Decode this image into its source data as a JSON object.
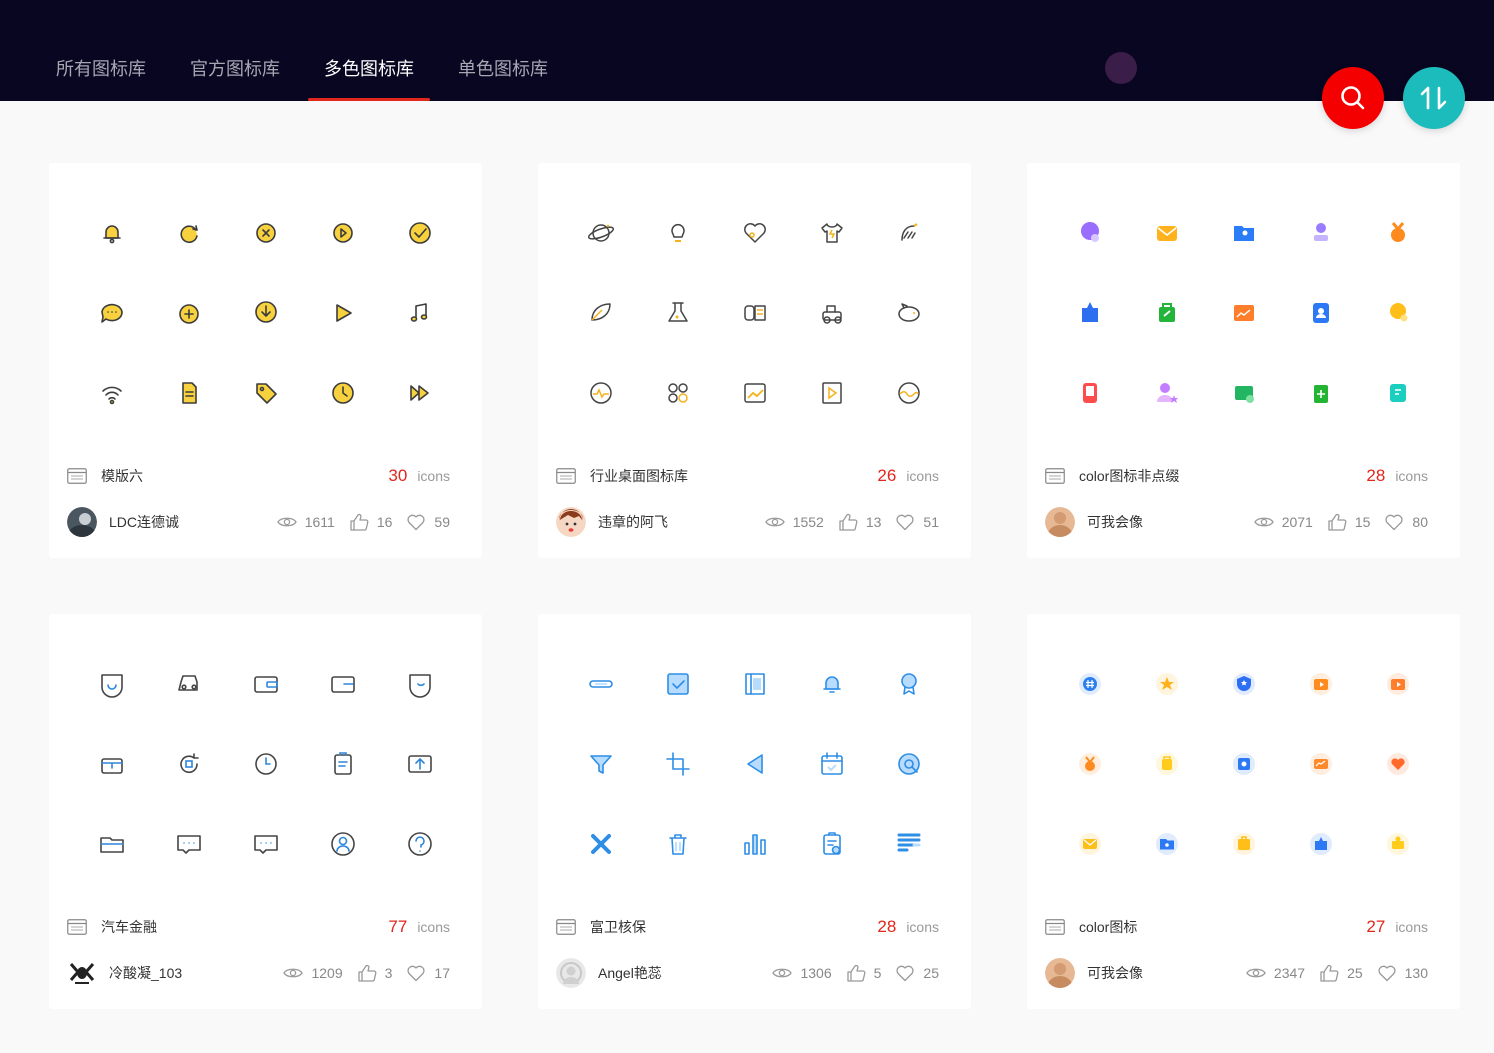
{
  "nav": {
    "tabs": [
      {
        "label": "所有图标库"
      },
      {
        "label": "官方图标库"
      },
      {
        "label": "多色图标库"
      },
      {
        "label": "单色图标库"
      }
    ],
    "active_index": 2
  },
  "colors": {
    "header_bg": "#080620",
    "active_underline": "#e1261c",
    "search_fab": "#f50000",
    "sort_fab": "#1cbcbc",
    "count_red": "#e1261c"
  },
  "fabs": {
    "search_icon": "search-icon",
    "sort_icon": "sort-arrows-icon"
  },
  "cards": [
    {
      "name": "模版六",
      "count": "30",
      "unit": "icons",
      "author": "LDC连德诚",
      "views": "1611",
      "likes": "16",
      "favorites": "59"
    },
    {
      "name": "行业桌面图标库",
      "count": "26",
      "unit": "icons",
      "author": "违章的阿飞",
      "views": "1552",
      "likes": "13",
      "favorites": "51"
    },
    {
      "name": "color图标非点缀",
      "count": "28",
      "unit": "icons",
      "author": "可我会像",
      "views": "2071",
      "likes": "15",
      "favorites": "80"
    },
    {
      "name": "汽车金融",
      "count": "77",
      "unit": "icons",
      "author": "冷酸凝_103",
      "views": "1209",
      "likes": "3",
      "favorites": "17"
    },
    {
      "name": "富卫核保",
      "count": "28",
      "unit": "icons",
      "author": "Angel艳蕊",
      "views": "1306",
      "likes": "5",
      "favorites": "25"
    },
    {
      "name": "color图标",
      "count": "27",
      "unit": "icons",
      "author": "可我会像",
      "views": "2347",
      "likes": "25",
      "favorites": "130"
    }
  ]
}
